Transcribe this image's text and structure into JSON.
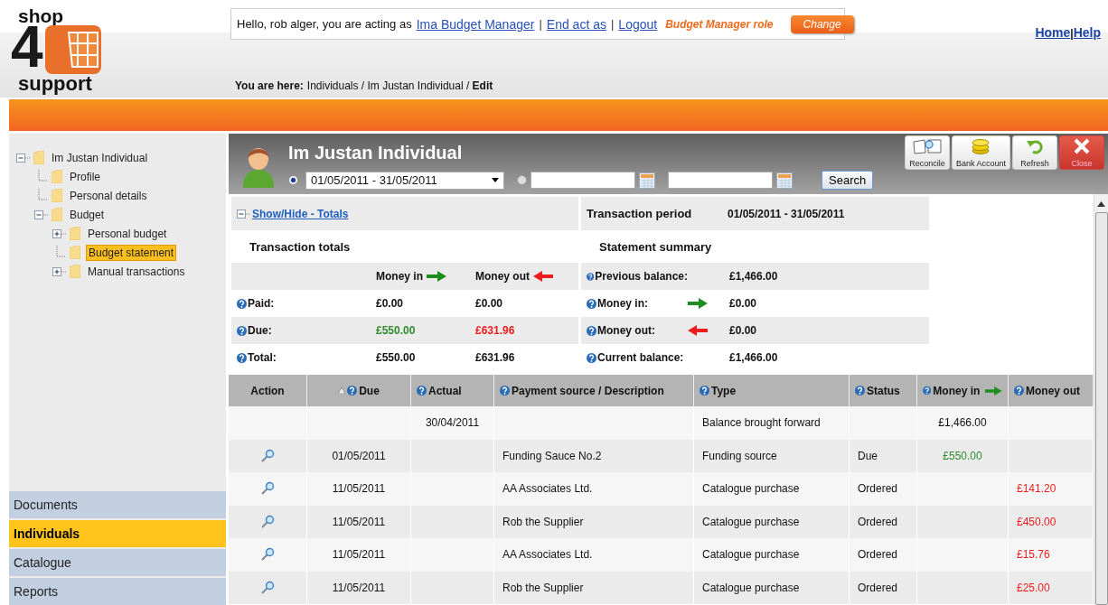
{
  "logo": {
    "top": "shop",
    "digit": "4",
    "bottom": "support"
  },
  "session": {
    "greeting": "Hello, rob alger, you are acting as",
    "links": [
      {
        "label": "Ima Budget Manager"
      },
      {
        "label": "End act as"
      },
      {
        "label": "Logout"
      }
    ],
    "separators": [
      "|",
      "|"
    ],
    "role": "Budget Manager role",
    "change_button": "Change"
  },
  "top_links": [
    {
      "label": "Home"
    },
    {
      "label": "Help"
    }
  ],
  "top_links_separator": "|",
  "breadcrumb": {
    "label": "You are here:",
    "path": "Individuals / Im Justan Individual / **Edit**"
  },
  "tree": [
    {
      "label": "Im Justan Individual",
      "selected": false,
      "expanded": true,
      "children": [
        {
          "label": "Profile",
          "selected": false
        },
        {
          "label": "Personal details",
          "selected": false
        },
        {
          "label": "Budget",
          "selected": false,
          "expanded": true,
          "children": [
            {
              "label": "Personal budget",
              "selected": false,
              "expanded": false
            },
            {
              "label": "Budget statement",
              "selected": true
            },
            {
              "label": "Manual transactions",
              "selected": false,
              "expanded": false
            }
          ]
        }
      ]
    }
  ],
  "nav": [
    {
      "label": "Documents",
      "selected": false
    },
    {
      "label": "Individuals",
      "selected": true
    },
    {
      "label": "Catalogue",
      "selected": false
    },
    {
      "label": "Reports",
      "selected": false
    }
  ],
  "individual": {
    "name": "Im Justan Individual",
    "period_option": {
      "selected": true,
      "value": "01/05/2011 - 31/05/2011"
    },
    "custom_option": {
      "selected": false
    },
    "search_button": "Search"
  },
  "toolbar": [
    {
      "label": "Reconcile",
      "kind": "reconcile"
    },
    {
      "label": "Bank Account",
      "kind": "bank"
    },
    {
      "label": "Refresh",
      "kind": "refresh"
    },
    {
      "label": "Close",
      "kind": "close"
    }
  ],
  "totals": {
    "toggle_link": "Show/Hide - Totals",
    "title": "Transaction totals",
    "money_in_header": "Money in",
    "money_out_header": "Money out",
    "rows": [
      {
        "label": "Paid:",
        "kind": "paid",
        "money_in": "£0.00",
        "money_out": "£0.00"
      },
      {
        "label": "Due:",
        "kind": "due",
        "money_in": "£550.00",
        "money_out": "£631.96"
      },
      {
        "label": "Total:",
        "kind": "total",
        "money_in": "£550.00",
        "money_out": "£631.96"
      }
    ]
  },
  "summary": {
    "period_label": "Transaction period",
    "period": "01/05/2011 - 31/05/2011",
    "title": "Statement summary",
    "rows": [
      {
        "label": "Previous balance:",
        "kind": "plain",
        "value": "£1,466.00"
      },
      {
        "label": "Money in:",
        "kind": "in",
        "value": "£0.00"
      },
      {
        "label": "Money out:",
        "kind": "out",
        "value": "£0.00"
      },
      {
        "label": "Current balance:",
        "kind": "plain",
        "value": "£1,466.00"
      }
    ]
  },
  "table": {
    "columns": [
      {
        "label": "Action",
        "help": false,
        "sorted": false,
        "arrow": false
      },
      {
        "label": "Due",
        "help": true,
        "sorted": true,
        "arrow": false
      },
      {
        "label": "Actual",
        "help": true,
        "sorted": false,
        "arrow": false
      },
      {
        "label": "Payment source / Description",
        "help": true,
        "sorted": false,
        "arrow": false
      },
      {
        "label": "Type",
        "help": true,
        "sorted": false,
        "arrow": false
      },
      {
        "label": "Status",
        "help": true,
        "sorted": false,
        "arrow": false
      },
      {
        "label": "Money in",
        "help": true,
        "sorted": false,
        "arrow": true
      },
      {
        "label": "Money out",
        "help": true,
        "sorted": false,
        "arrow": false
      }
    ],
    "rows": [
      {
        "kind": "balance",
        "action": false,
        "actual": "30/04/2011",
        "type": "Balance brought forward",
        "money_in": "£1,466.00"
      },
      {
        "kind": "transaction",
        "action": true,
        "due": "01/05/2011",
        "description": "Funding Sauce No.2",
        "type": "Funding source",
        "status": "Due",
        "money_in": "£550.00"
      },
      {
        "kind": "transaction",
        "action": true,
        "due": "11/05/2011",
        "description": "AA Associates Ltd.",
        "type": "Catalogue purchase",
        "status": "Ordered",
        "money_out": "£141.20"
      },
      {
        "kind": "transaction",
        "action": true,
        "due": "11/05/2011",
        "description": "Rob the Supplier",
        "type": "Catalogue purchase",
        "status": "Ordered",
        "money_out": "£450.00"
      },
      {
        "kind": "transaction",
        "action": true,
        "due": "11/05/2011",
        "description": "AA Associates Ltd.",
        "type": "Catalogue purchase",
        "status": "Ordered",
        "money_out": "£15.76"
      },
      {
        "kind": "transaction",
        "action": true,
        "due": "11/05/2011",
        "description": "Rob the Supplier",
        "type": "Catalogue purchase",
        "status": "Ordered",
        "money_out": "£25.00"
      }
    ]
  }
}
